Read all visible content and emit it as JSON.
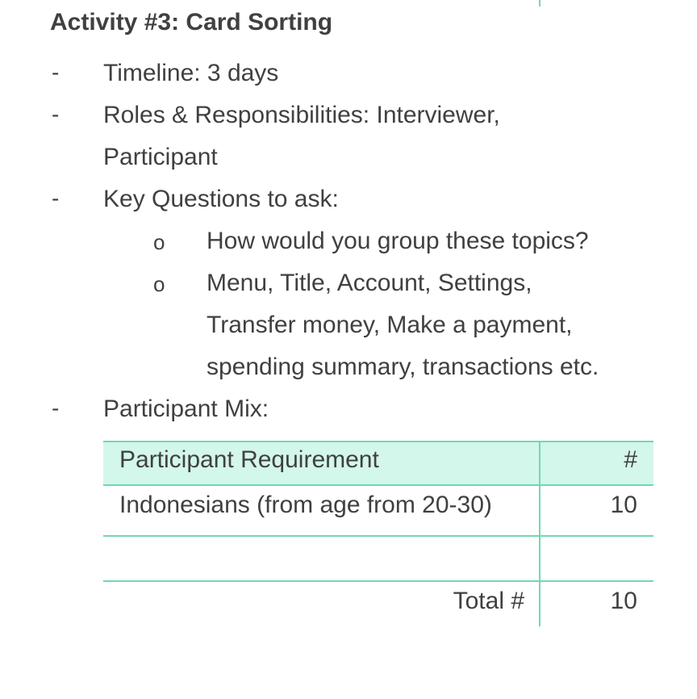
{
  "heading": "Activity #3: Card Sorting",
  "dash_glyph": "-",
  "bullet_glyph": "o",
  "items": {
    "timeline": "Timeline: 3 days",
    "roles_line1": "Roles & Responsibilities: Interviewer,",
    "roles_line2": "Participant",
    "key_questions": "Key Questions to ask:",
    "participant_mix": "Participant Mix:"
  },
  "questions": {
    "q1": "How would you group these topics?",
    "q2_line1": "Menu, Title, Account, Settings,",
    "q2_line2": "Transfer money, Make a payment,",
    "q2_line3": "spending summary, transactions etc."
  },
  "table": {
    "header_requirement": "Participant Requirement",
    "header_count": "#",
    "row1_requirement": "Indonesians (from age from 20-30)",
    "row1_count": "10",
    "row2_requirement": "",
    "row2_count": "",
    "total_label": "Total #",
    "total_count": "10"
  },
  "colors": {
    "text": "#404040",
    "table_border": "#6fd9ae",
    "table_header_bg": "#d3f7ea"
  }
}
